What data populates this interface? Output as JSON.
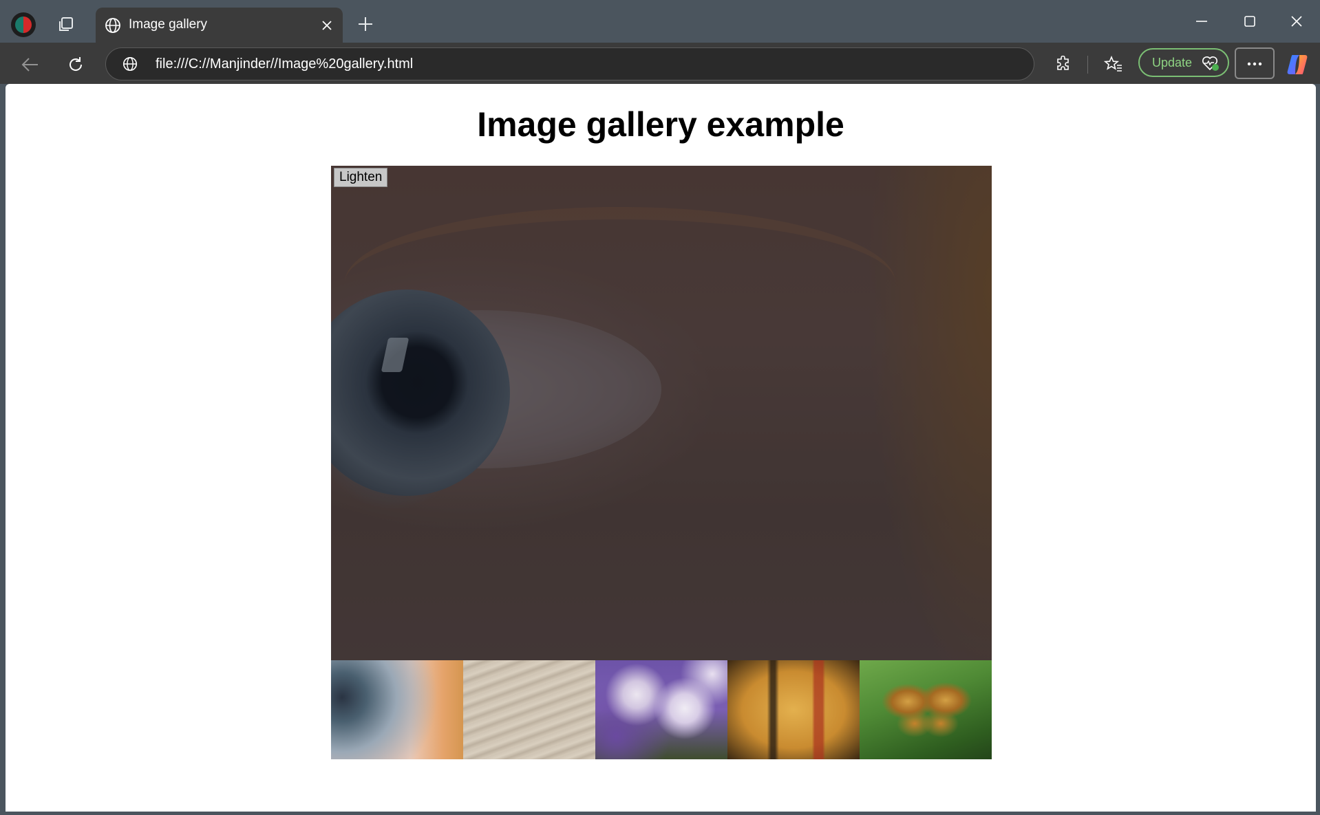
{
  "browser": {
    "tab": {
      "title": "Image gallery",
      "favicon": "globe-icon"
    },
    "address": {
      "url": "file:///C://Manjinder//Image%20gallery.html",
      "icon": "globe-icon"
    },
    "update_label": "Update",
    "colors": {
      "frame": "#4b555e",
      "toolbar": "#3b3b3b",
      "update_accent": "#7bbf74"
    }
  },
  "page": {
    "heading": "Image gallery example",
    "main_image": {
      "depicts": "eye",
      "darkened": true
    },
    "lighten_button": "Lighten",
    "thumbnails": [
      {
        "depicts": "eye"
      },
      {
        "depicts": "rock"
      },
      {
        "depicts": "flowers"
      },
      {
        "depicts": "egyptian-painting"
      },
      {
        "depicts": "butterfly"
      }
    ]
  }
}
